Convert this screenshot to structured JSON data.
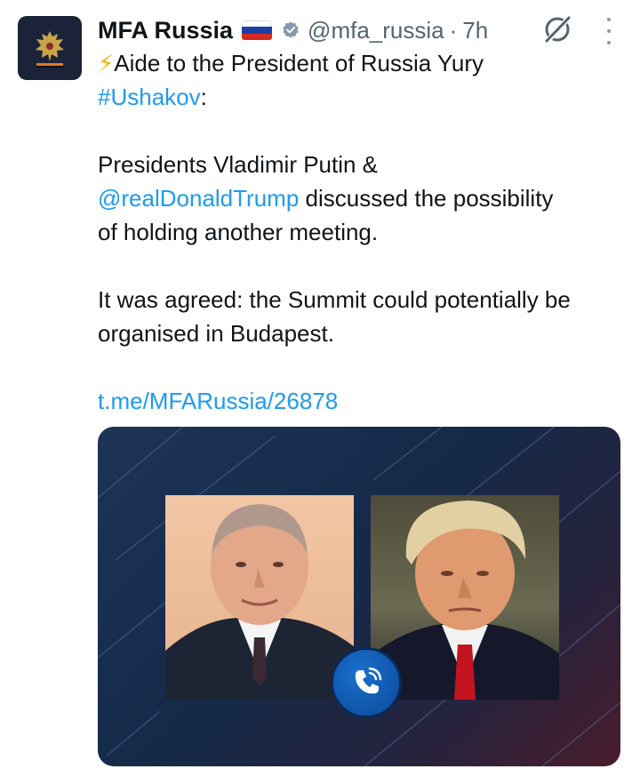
{
  "account": {
    "display_name": "MFA Russia",
    "handle": "@mfa_russia",
    "separator": "·",
    "time": "7h"
  },
  "icons": {
    "avatar": "russian-eagle-emblem-icon",
    "flag": "russia-flag-icon",
    "verified": "verified-badge-icon",
    "grok": "grok-icon",
    "more": "more-options-icon",
    "lightning": "lightning-icon",
    "call": "phone-call-icon"
  },
  "colors": {
    "link": "#1d9bf0",
    "text": "#0f1419",
    "secondary": "#536471",
    "flag_white": "#ffffff",
    "flag_blue": "#1c3fa7",
    "flag_red": "#d52b1e"
  },
  "tweet": {
    "line1_prefix": "⚡",
    "line1_text": "Aide to the President of Russia Yury",
    "hashtag": "#Ushakov",
    "hashtag_suffix": ":",
    "p2_text1": "Presidents Vladimir Putin &",
    "mention": "@realDonaldTrump",
    "p2_text2": " discussed the possibility",
    "p2_text3": "of holding another meeting.",
    "p3_line1": "It was agreed: the Summit could potentially be",
    "p3_line2": "organised in Budapest.",
    "url": "t.me/MFARussia/26878"
  }
}
